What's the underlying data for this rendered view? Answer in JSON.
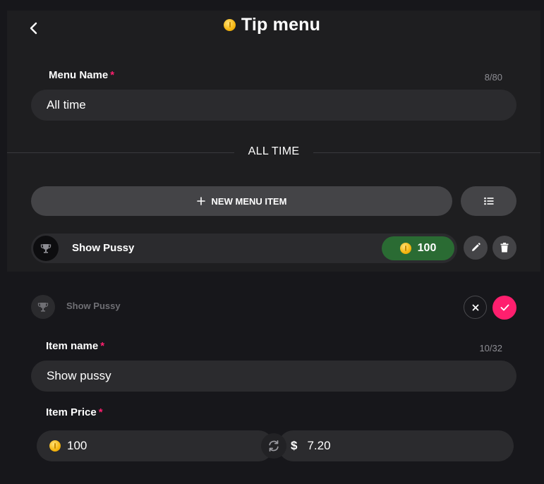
{
  "header": {
    "title": "Tip menu",
    "back_icon": "chevron-left-icon",
    "coin_icon": "token-coin-icon"
  },
  "menu_name": {
    "label": "Menu Name",
    "required_mark": "*",
    "counter": "8/80",
    "value": "All time"
  },
  "section": {
    "title": "ALL TIME"
  },
  "toolbar": {
    "new_item_label": "NEW MENU ITEM",
    "new_item_icon": "plus-icon",
    "list_icon": "list-icon"
  },
  "menu_items": [
    {
      "name": "Show Pussy",
      "icon": "trophy-icon",
      "price": "100",
      "price_color": "#2a6b33",
      "edit_icon": "pencil-icon",
      "delete_icon": "trash-icon"
    }
  ],
  "edit_form": {
    "preview_name": "Show Pussy",
    "preview_icon": "trophy-icon",
    "cancel_icon": "close-icon",
    "confirm_icon": "check-icon",
    "item_name": {
      "label": "Item name",
      "required_mark": "*",
      "counter": "10/32",
      "value": "Show pussy"
    },
    "item_price": {
      "label": "Item Price",
      "required_mark": "*",
      "tokens_value": "100",
      "currency_symbol": "$",
      "usd_value": "7.20",
      "swap_icon": "refresh-icon"
    }
  },
  "colors": {
    "accent": "#ff1f6e",
    "price_green": "#2a6b33",
    "field_bg": "#2b2b2e",
    "button_bg": "#444447"
  }
}
